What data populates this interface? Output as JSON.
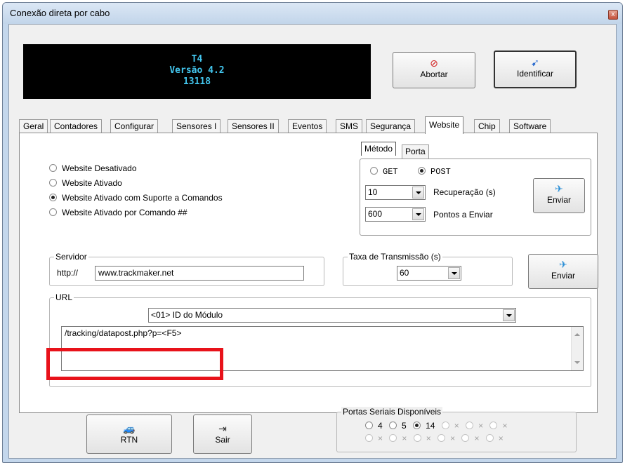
{
  "window": {
    "title": "Conexão direta por cabo",
    "close_glyph": "x"
  },
  "device": {
    "model": "T4",
    "version": "Versão 4.2",
    "serial": "13118"
  },
  "header_buttons": {
    "abort": {
      "label": "Abortar",
      "icon": "no-entry-icon",
      "glyph": "⊘"
    },
    "identify": {
      "label": "Identificar",
      "icon": "device-identify-icon",
      "glyph": "➹"
    }
  },
  "tabs": [
    {
      "label": "Geral"
    },
    {
      "label": "Contadores"
    },
    {
      "label": "Configurar"
    },
    {
      "label": "Sensores I"
    },
    {
      "label": "Sensores II"
    },
    {
      "label": "Eventos"
    },
    {
      "label": "SMS"
    },
    {
      "label": "Segurança"
    },
    {
      "label": "Website",
      "active": true
    },
    {
      "label": "Chip"
    },
    {
      "label": "Software"
    }
  ],
  "website_modes": {
    "options": [
      {
        "label": "Website Desativado",
        "selected": false
      },
      {
        "label": "Website Ativado",
        "selected": false
      },
      {
        "label": "Website Ativado com Suporte a Comandos",
        "selected": true
      },
      {
        "label": "Website Ativado por Comando ##",
        "selected": false
      }
    ]
  },
  "method_panel": {
    "tabs": [
      {
        "label": "Método",
        "active": true
      },
      {
        "label": "Porta",
        "active": false
      }
    ],
    "get_label": "GET",
    "post_label": "POST",
    "selected": "POST",
    "recovery_value": "10",
    "recovery_label": "Recuperação (s)",
    "points_value": "600",
    "points_label": "Pontos a Enviar",
    "send_label": "Enviar"
  },
  "server": {
    "legend": "Servidor",
    "prefix": "http://",
    "value": "www.trackmaker.net"
  },
  "transmission": {
    "legend": "Taxa de Transmissão (s)",
    "value": "60",
    "send_label": "Enviar"
  },
  "url": {
    "legend": "URL",
    "field_select": "<01> ID do Módulo",
    "value": "/tracking/datapost.php?p=<F5>"
  },
  "bottom_buttons": {
    "rtn": {
      "label": "RTN",
      "glyph": "🚙"
    },
    "exit": {
      "label": "Sair",
      "glyph": "⇥"
    }
  },
  "serial_ports": {
    "legend": "Portas Seriais Disponíveis",
    "row1": [
      {
        "label": "4",
        "selected": false,
        "enabled": true
      },
      {
        "label": "5",
        "selected": false,
        "enabled": true
      },
      {
        "label": "14",
        "selected": true,
        "enabled": true
      },
      {
        "label": "×",
        "selected": false,
        "enabled": false
      },
      {
        "label": "×",
        "selected": false,
        "enabled": false
      },
      {
        "label": "×",
        "selected": false,
        "enabled": false
      }
    ],
    "row2": [
      {
        "label": "×",
        "selected": false,
        "enabled": false
      },
      {
        "label": "×",
        "selected": false,
        "enabled": false
      },
      {
        "label": "×",
        "selected": false,
        "enabled": false
      },
      {
        "label": "×",
        "selected": false,
        "enabled": false
      },
      {
        "label": "×",
        "selected": false,
        "enabled": false
      },
      {
        "label": "×",
        "selected": false,
        "enabled": false
      }
    ]
  },
  "colors": {
    "lcd_text": "#43c6ee",
    "highlight": "#e8121a",
    "send_icon": "#2b8fd6"
  }
}
